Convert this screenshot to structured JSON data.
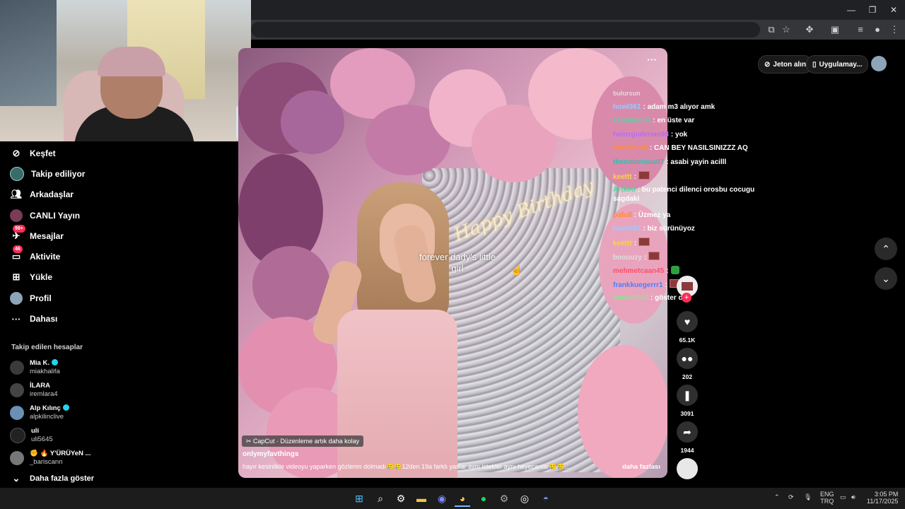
{
  "browser": {
    "window_controls": {
      "minimize": "—",
      "maximize": "❐",
      "close": "✕"
    },
    "toolbar_icons": [
      "install-icon",
      "star-icon",
      "extensions-icon",
      "sidebar-icon",
      "media-icon",
      "profile-icon",
      "menu-icon"
    ]
  },
  "sidebar": {
    "nav": [
      {
        "label": "Keşfet",
        "icon": "compass-icon"
      },
      {
        "label": "Takip ediliyor",
        "icon": "following-icon"
      },
      {
        "label": "Arkadaşlar",
        "icon": "friends-icon"
      },
      {
        "label": "CANLI Yayın",
        "icon": "live-icon"
      },
      {
        "label": "Mesajlar",
        "icon": "messages-icon",
        "badge": "99+"
      },
      {
        "label": "Aktivite",
        "icon": "activity-icon",
        "badge": "46"
      },
      {
        "label": "Yükle",
        "icon": "upload-icon"
      },
      {
        "label": "Profil",
        "icon": "profile-icon"
      },
      {
        "label": "Dahası",
        "icon": "more-icon"
      }
    ],
    "followed_title": "Takip edilen hesaplar",
    "accounts": [
      {
        "name": "Mia K.",
        "handle": "miakhalifa",
        "verified": true
      },
      {
        "name": "İLARA",
        "handle": "iremlara4",
        "verified": false
      },
      {
        "name": "Alp Kılınç",
        "handle": "alpkilinclive",
        "verified": true
      },
      {
        "name": "uli",
        "handle": "uli5645",
        "verified": false
      },
      {
        "name": "✊ 🔥 Y'ÜRÜYeN ...",
        "handle": "_bariscann",
        "verified": false
      }
    ],
    "show_more": "Daha fazla göster"
  },
  "video": {
    "overlay_text": "forever dady's little girl",
    "neon_script": "Happy Birthday",
    "more": "···",
    "capcut": "CapCut · Düzenleme artık daha kolay",
    "author": "onlymyfavthings",
    "caption": "hayır kesinlikle videoyu yaparken gözlerim dolmadı🥲🥲12den 19a farklı yaslar aynı istekler aynı heyecanlar🥲🥲...",
    "see_more": "daha fazlası"
  },
  "chat": [
    {
      "user": "",
      "text": "bulursun",
      "color": "#ffffff"
    },
    {
      "user": "howl361",
      "text": ": adam m3 alıyor amk",
      "color": "#9ec9ff"
    },
    {
      "user": "keremgduk",
      "text": ": en üste var",
      "color": "#4dd8a0"
    },
    {
      "user": "heinzguderian98",
      "text": ": yok",
      "color": "#b46cff"
    },
    {
      "user": "remzizztrk",
      "text": ": CAN BEY NASILSINIZZZ AQ",
      "color": "#ff8a3d"
    },
    {
      "user": "thenotorious07",
      "text": ": asabi yayin acilll",
      "color": "#2fbfb0"
    },
    {
      "user": "keettt",
      "text": ":",
      "color": "#ffd23f",
      "emote": true
    },
    {
      "user": "Artkeo",
      "text": ": bu patenci dilenci orosbu cocugu sagdaki",
      "color": "#4dd8a0"
    },
    {
      "user": "pafull",
      "text": ": Üzmez ya",
      "color": "#ff8a3d"
    },
    {
      "user": "howl361",
      "text": ": biz sürünüyoz",
      "color": "#9ec9ff"
    },
    {
      "user": "keettt",
      "text": ":",
      "color": "#ffd23f",
      "emote": true
    },
    {
      "user": "boouuzy",
      "text": ":",
      "color": "#dddddd",
      "emote": true
    },
    {
      "user": "mehmetcaan45",
      "text": ":",
      "color": "#ff4d6d",
      "emote_green": true
    },
    {
      "user": "frankkuegerrr1",
      "text": ":",
      "color": "#4d7dff",
      "emote": true
    },
    {
      "user": "murat7933",
      "text": ": göster de",
      "color": "#8fe38f"
    }
  ],
  "actions": {
    "likes": "65.1K",
    "comments": "202",
    "saves": "3091",
    "shares": "1944"
  },
  "top_right": {
    "coins": "Jeton alın",
    "app": "Uygulamay..."
  },
  "taskbar": {
    "apps": [
      "windows-icon",
      "search-icon",
      "steam-icon",
      "files-icon",
      "app-icon",
      "chrome-icon",
      "spotify-icon",
      "settings-icon",
      "app2-icon",
      "discord-icon"
    ],
    "lang_top": "ENG",
    "lang_bottom": "TRQ",
    "time": "3:05 PM",
    "date": "11/17/2025"
  }
}
